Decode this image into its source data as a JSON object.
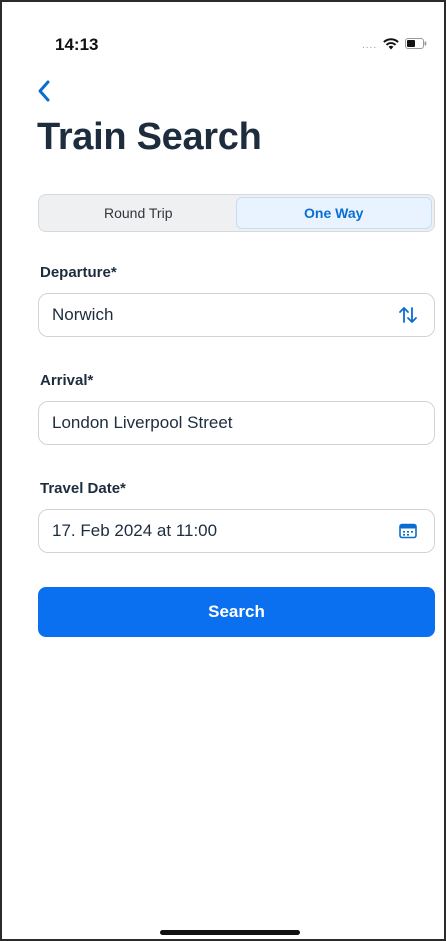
{
  "status": {
    "time": "14:13",
    "signal": "....",
    "icons": [
      "wifi-icon",
      "battery-icon"
    ]
  },
  "header": {
    "back_icon": "chevron-left-icon",
    "title": "Train Search"
  },
  "trip_type": {
    "options": [
      "Round Trip",
      "One Way"
    ],
    "selected": "One Way"
  },
  "form": {
    "departure": {
      "label": "Departure*",
      "value": "Norwich",
      "swap_icon": "swap-arrows-icon"
    },
    "arrival": {
      "label": "Arrival*",
      "value": "London Liverpool Street"
    },
    "travel_date": {
      "label": "Travel Date*",
      "value": "17. Feb 2024 at 11:00",
      "icon": "calendar-icon"
    }
  },
  "actions": {
    "search_label": "Search"
  },
  "colors": {
    "accent": "#0a70f0",
    "title": "#1d2d3e",
    "segment_active_bg": "#e8f3ff"
  }
}
